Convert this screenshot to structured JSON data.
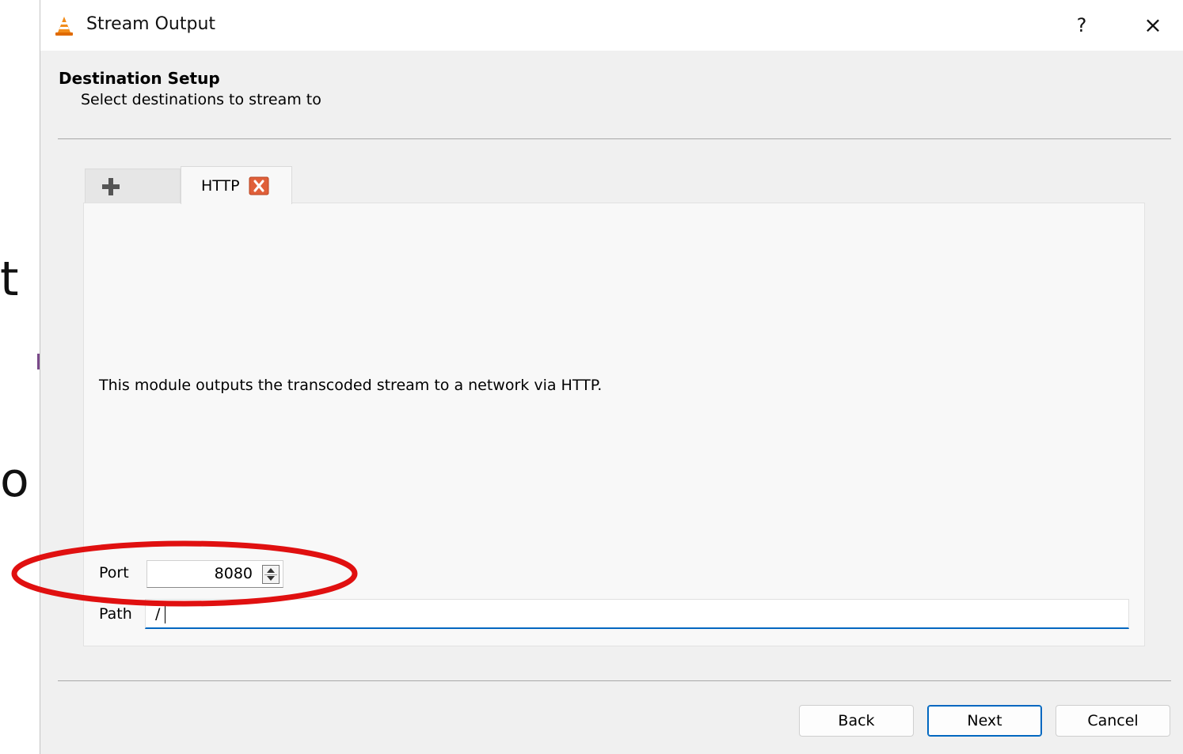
{
  "background": {
    "partial_glyph_top": "t",
    "partial_glyph_bottom": "o"
  },
  "dialog": {
    "title": "Stream Output",
    "help_label": "?",
    "close_label": "×"
  },
  "header": {
    "heading": "Destination Setup",
    "subheading": "Select destinations to stream to"
  },
  "tabs": [
    {
      "label": "",
      "icon": "plus-icon"
    },
    {
      "label": "HTTP",
      "icon": "close-tab-icon",
      "selected": true
    }
  ],
  "module": {
    "description": "This module outputs the transcoded stream to a network via HTTP.",
    "port_label": "Port",
    "port_value": "8080",
    "path_label": "Path",
    "path_value": "/"
  },
  "buttons": {
    "back": "Back",
    "next": "Next",
    "cancel": "Cancel"
  },
  "colors": {
    "accent": "#0067c0",
    "highlight_ellipse": "#e01010",
    "tab_close": "#e0603a"
  }
}
